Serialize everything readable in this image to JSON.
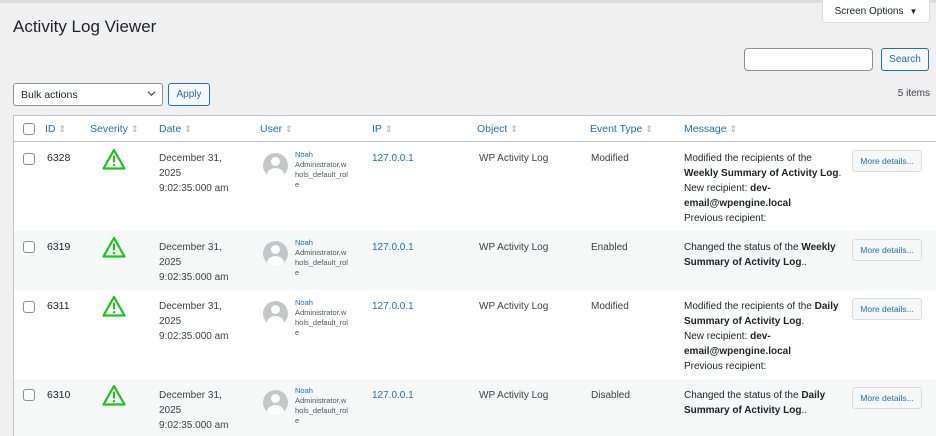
{
  "screen_options": {
    "label": "Screen Options",
    "caret": "▼"
  },
  "page_title": "Activity Log Viewer",
  "search": {
    "value": "",
    "button_label": "Search"
  },
  "bulk": {
    "selected": "Bulk actions",
    "apply_label": "Apply"
  },
  "items_count": "5 items",
  "columns": {
    "id": "ID",
    "severity": "Severity",
    "date": "Date",
    "user": "User",
    "ip": "IP",
    "object": "Object",
    "event_type": "Event Type",
    "message": "Message"
  },
  "colors": {
    "accent": "#2271b1",
    "severity_icon": "#1ec41e"
  },
  "rows": [
    {
      "id": "6328",
      "severity_icon": "warning-icon",
      "date": [
        "December 31,",
        "2025",
        "9:02:35.000 am"
      ],
      "user": {
        "name": "Noah",
        "role": [
          "Administrator,w",
          "hols_default_rol",
          "e"
        ]
      },
      "ip": "127.0.0.1",
      "object": "WP Activity Log",
      "event_type": "Modified",
      "message": {
        "p1": "Modified the recipients of the ",
        "b1": "Weekly Summary of Activity Log",
        "p2": ".",
        "new_label": "New recipient: ",
        "new_value_1": "dev-",
        "new_value_2": "email@wpengine.local",
        "prev_label": "Previous recipient:"
      },
      "more_label": "More details..."
    },
    {
      "id": "6319",
      "severity_icon": "warning-icon",
      "date": [
        "December 31,",
        "2025",
        "9:02:35.000 am"
      ],
      "user": {
        "name": "Noah",
        "role": [
          "Administrator,w",
          "hols_default_rol",
          "e"
        ]
      },
      "ip": "127.0.0.1",
      "object": "WP Activity Log",
      "event_type": "Enabled",
      "message": {
        "p1": "Changed the status of the ",
        "b1": "Weekly",
        "b2": "Summary of Activity Log",
        "p2": ".."
      },
      "more_label": "More details..."
    },
    {
      "id": "6311",
      "severity_icon": "warning-icon",
      "date": [
        "December 31,",
        "2025",
        "9:02:35.000 am"
      ],
      "user": {
        "name": "Noah",
        "role": [
          "Administrator,w",
          "hols_default_rol",
          "e"
        ]
      },
      "ip": "127.0.0.1",
      "object": "WP Activity Log",
      "event_type": "Modified",
      "message": {
        "p1": "Modified the recipients of the ",
        "b1": "Daily",
        "b2": "Summary of Activity Log",
        "p2": ".",
        "new_label": "New recipient: ",
        "new_value_1": "dev-",
        "new_value_2": "email@wpengine.local",
        "prev_label": "Previous recipient:"
      },
      "more_label": "More details..."
    },
    {
      "id": "6310",
      "severity_icon": "warning-icon",
      "date": [
        "December 31,",
        "2025",
        "9:02:35.000 am"
      ],
      "user": {
        "name": "Noah",
        "role": [
          "Administrator,w",
          "hols_default_rol",
          "e"
        ]
      },
      "ip": "127.0.0.1",
      "object": "WP Activity Log",
      "event_type": "Disabled",
      "message": {
        "p1": "Changed the status of the ",
        "b1": "Daily",
        "b2": "Summary of Activity Log",
        "p2": ".."
      },
      "more_label": "More details..."
    }
  ]
}
